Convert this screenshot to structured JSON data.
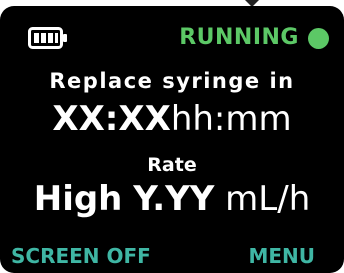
{
  "colors": {
    "background": "#000000",
    "text": "#ffffff",
    "accent_green": "#5cc866",
    "softkey_teal": "#3fb6a4"
  },
  "header": {
    "battery_icon": "battery-full-icon",
    "battery_level": 1.0,
    "status_label": "RUNNING",
    "status_indicator_icon": "status-dot-icon"
  },
  "replace": {
    "label": "Replace syringe in",
    "time_value": "XX:XX",
    "time_unit": "hh:mm"
  },
  "rate": {
    "label": "Rate",
    "level": "High",
    "value": "Y.YY",
    "unit": "mL/h"
  },
  "softkeys": {
    "left_label": "SCREEN OFF",
    "right_label": "MENU"
  }
}
